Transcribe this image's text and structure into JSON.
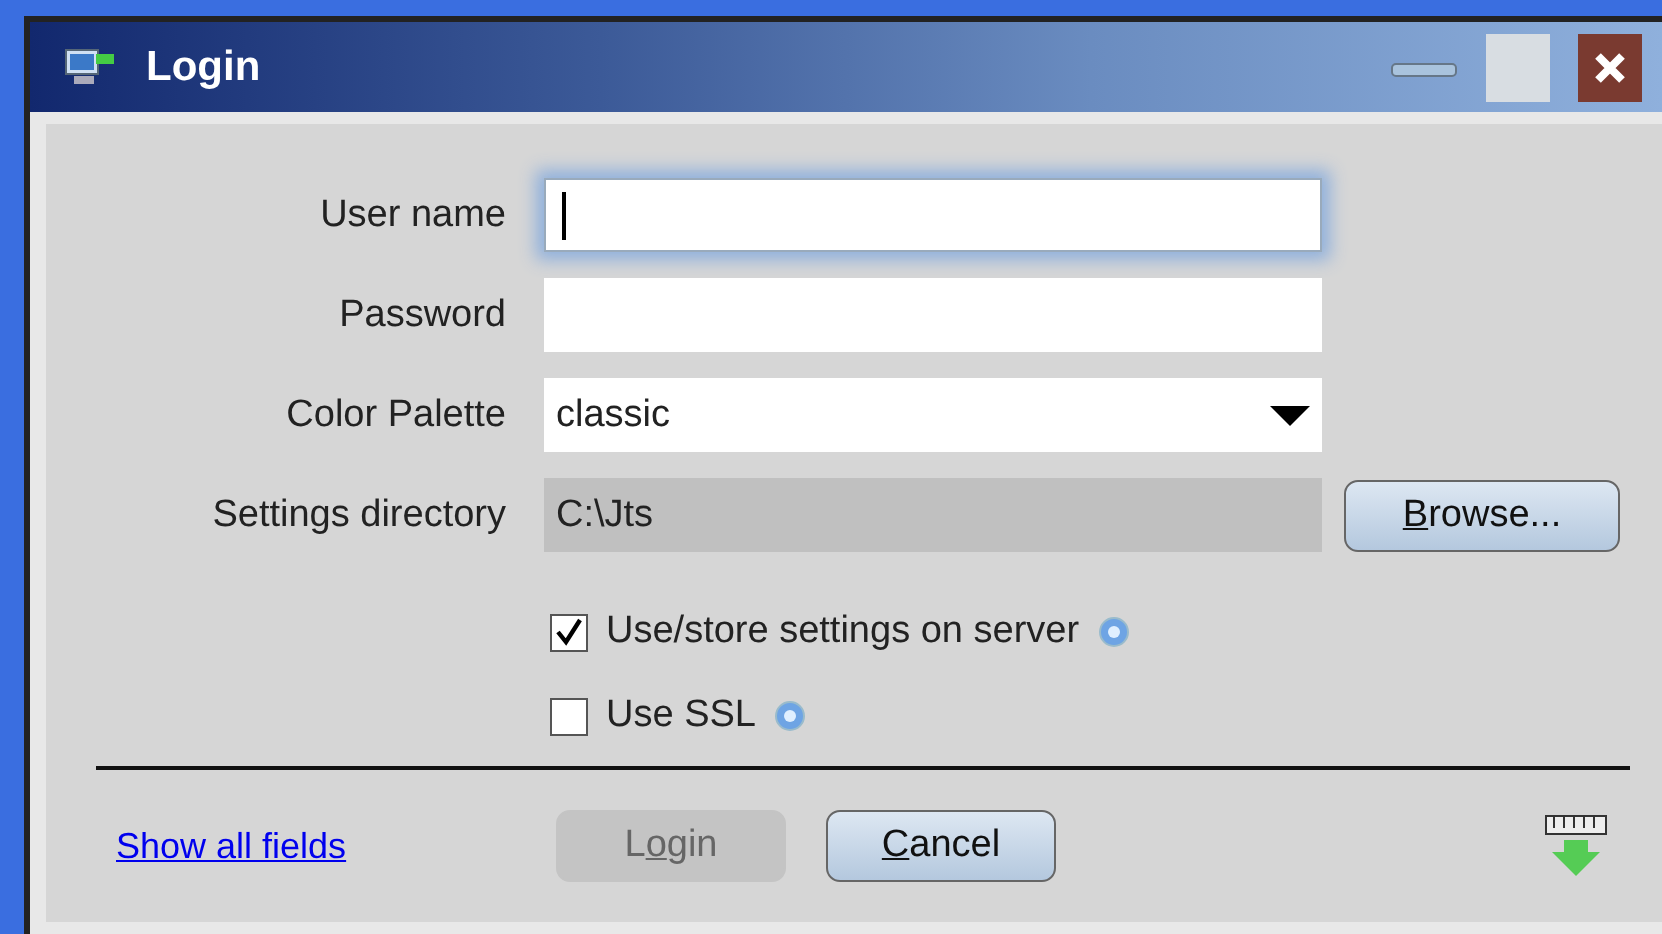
{
  "window": {
    "title": "Login"
  },
  "fields": [
    {
      "kind": "text",
      "label": "User name",
      "focused": true
    },
    {
      "kind": "text",
      "label": "Password",
      "focused": false
    },
    {
      "kind": "select",
      "label": "Color Palette",
      "value": "classic"
    },
    {
      "kind": "readonly",
      "label": "Settings directory",
      "value": "C:\\Jts",
      "button": {
        "key": "B",
        "after": "rowse..."
      }
    }
  ],
  "options": [
    {
      "label": "Use/store settings on server",
      "checked": true
    },
    {
      "label": "Use SSL",
      "checked": false
    }
  ],
  "footer": {
    "link": "Show all fields",
    "buttons": [
      {
        "before": "L",
        "key": "o",
        "after": "gin",
        "disabled": true
      },
      {
        "key": "C",
        "after": "ancel",
        "disabled": false
      }
    ]
  }
}
